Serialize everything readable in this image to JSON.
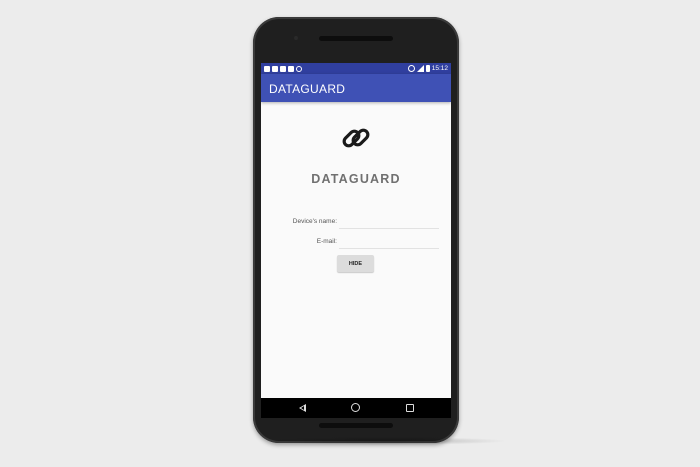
{
  "status_bar": {
    "time": "15:12"
  },
  "app_bar": {
    "title": "DATAGUARD"
  },
  "logo": {
    "icon": "link-icon",
    "text": "DATAGUARD"
  },
  "form": {
    "device_label": "Device's name:",
    "device_value": "",
    "email_label": "E-mail:",
    "email_value": "",
    "hide_button": "HIDE"
  },
  "nav": {
    "back_icon": "back-triangle-icon",
    "home_icon": "home-circle-icon",
    "recents_icon": "recents-square-icon"
  },
  "colors": {
    "status_bar": "#303f9f",
    "app_bar": "#3f51b5",
    "background": "#fafafa",
    "button": "#dcdcdc"
  }
}
